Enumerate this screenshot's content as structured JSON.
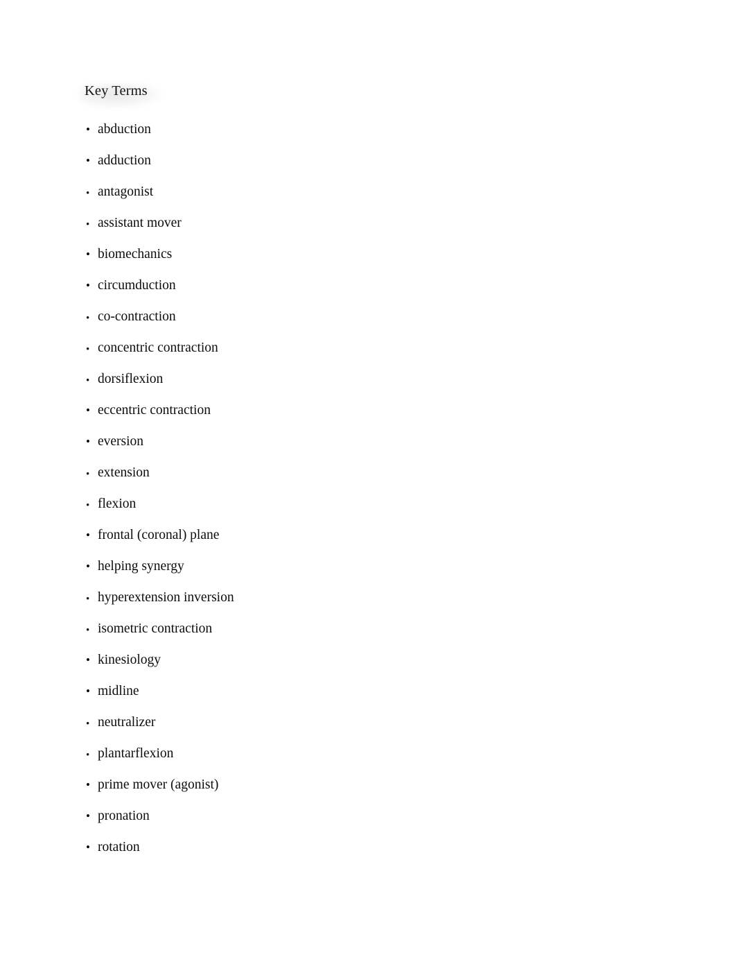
{
  "document": {
    "heading": "Key Terms",
    "bullet_glyph": "•",
    "text_color": "#0c0c0c",
    "background_color": "#ffffff",
    "terms": [
      {
        "label": "abduction",
        "bullet_style": "normal"
      },
      {
        "label": "adduction",
        "bullet_style": "normal"
      },
      {
        "label": "antagonist",
        "bullet_style": "low"
      },
      {
        "label": "assistant mover",
        "bullet_style": "low"
      },
      {
        "label": "biomechanics",
        "bullet_style": "normal"
      },
      {
        "label": "circumduction",
        "bullet_style": "normal"
      },
      {
        "label": "co-contraction",
        "bullet_style": "low"
      },
      {
        "label": "concentric contraction",
        "bullet_style": "low"
      },
      {
        "label": "dorsiflexion",
        "bullet_style": "low"
      },
      {
        "label": "eccentric contraction",
        "bullet_style": "normal"
      },
      {
        "label": "eversion",
        "bullet_style": "normal"
      },
      {
        "label": "extension",
        "bullet_style": "low"
      },
      {
        "label": "flexion",
        "bullet_style": "low"
      },
      {
        "label": "frontal (coronal) plane",
        "bullet_style": "normal"
      },
      {
        "label": "helping synergy",
        "bullet_style": "normal"
      },
      {
        "label": "hyperextension inversion",
        "bullet_style": "low"
      },
      {
        "label": "isometric contraction",
        "bullet_style": "low"
      },
      {
        "label": "kinesiology",
        "bullet_style": "normal"
      },
      {
        "label": "midline",
        "bullet_style": "normal"
      },
      {
        "label": "neutralizer",
        "bullet_style": "low"
      },
      {
        "label": "plantarflexion",
        "bullet_style": "low"
      },
      {
        "label": "prime mover (agonist)",
        "bullet_style": "normal"
      },
      {
        "label": "pronation",
        "bullet_style": "normal"
      },
      {
        "label": "rotation",
        "bullet_style": "normal"
      }
    ]
  }
}
